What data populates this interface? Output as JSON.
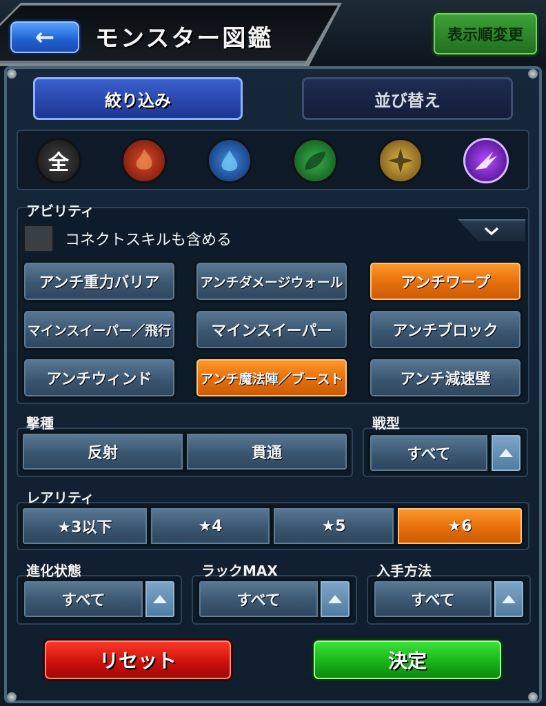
{
  "header": {
    "back_icon": "←",
    "title": "モンスター図鑑",
    "sort_order_label": "表示順変更"
  },
  "tabs": {
    "filter_label": "絞り込み",
    "sort_label": "並び替え"
  },
  "elements": [
    {
      "name": "all",
      "glyph": "全",
      "color": "#1c1c1c"
    },
    {
      "name": "fire",
      "glyph": "",
      "color": "#b3271c"
    },
    {
      "name": "water",
      "glyph": "",
      "color": "#1e4fb3"
    },
    {
      "name": "wood",
      "glyph": "",
      "color": "#1c7a2a"
    },
    {
      "name": "light",
      "glyph": "",
      "color": "#b08a25"
    },
    {
      "name": "dark",
      "glyph": "",
      "color": "#7a2ad1"
    }
  ],
  "ability": {
    "label": "アビリティ",
    "connect_skill_label": "コネクトスキルも含める",
    "buttons": [
      {
        "label": "アンチ重力バリア",
        "selected": false
      },
      {
        "label": "アンチダメージウォール",
        "selected": false
      },
      {
        "label": "アンチワープ",
        "selected": true
      },
      {
        "label": "マインスイーパー／飛行",
        "selected": false
      },
      {
        "label": "マインスイーパー",
        "selected": false
      },
      {
        "label": "アンチブロック",
        "selected": false
      },
      {
        "label": "アンチウィンド",
        "selected": false
      },
      {
        "label": "アンチ魔法陣／ブースト",
        "selected": true
      },
      {
        "label": "アンチ減速壁",
        "selected": false
      }
    ]
  },
  "attack_type": {
    "label": "撃種",
    "options": [
      "反射",
      "貫通"
    ]
  },
  "battle_type": {
    "label": "戦型",
    "value": "すべて"
  },
  "rarity": {
    "label": "レアリティ",
    "options": [
      {
        "label": "★3以下",
        "selected": false
      },
      {
        "label": "★4",
        "selected": false
      },
      {
        "label": "★5",
        "selected": false
      },
      {
        "label": "★6",
        "selected": true
      }
    ]
  },
  "evolution": {
    "label": "進化状態",
    "value": "すべて"
  },
  "luck_max": {
    "label": "ラックMAX",
    "value": "すべて"
  },
  "acquisition": {
    "label": "入手方法",
    "value": "すべて"
  },
  "actions": {
    "reset_label": "リセット",
    "confirm_label": "決定"
  },
  "colors": {
    "selected_orange": "#e56e0a",
    "button_blue": "#3b5670",
    "reset_red": "#c90f0a",
    "confirm_green": "#16b016"
  }
}
